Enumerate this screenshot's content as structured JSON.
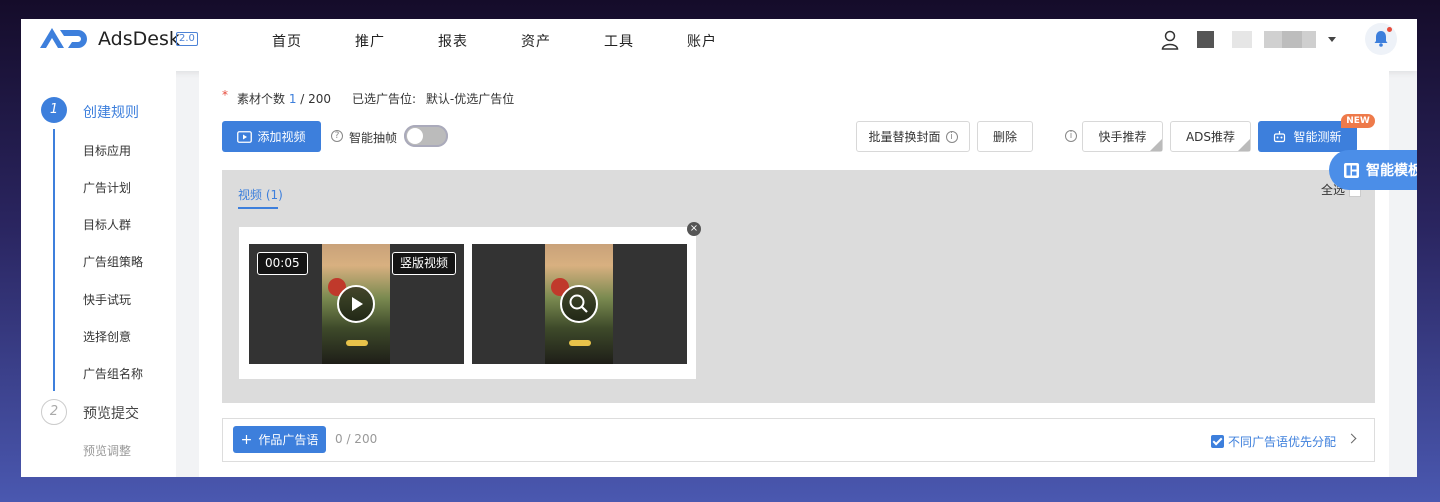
{
  "brand": {
    "name": "AdsDesk",
    "version": "2.0"
  },
  "nav": [
    "首页",
    "推广",
    "报表",
    "资产",
    "工具",
    "账户"
  ],
  "sidebar": {
    "step1": {
      "num": "1",
      "title": "创建规则"
    },
    "items": [
      "目标应用",
      "广告计划",
      "目标人群",
      "广告组策略",
      "快手试玩",
      "选择创意",
      "广告组名称"
    ],
    "step2": {
      "num": "2",
      "title": "预览提交"
    },
    "sub2": [
      "预览调整"
    ]
  },
  "main": {
    "required": "*",
    "count_label": "素材个数",
    "count_current": "1",
    "count_total": " / 200",
    "slot_label": "已选广告位:",
    "slot_value": "默认-优选广告位",
    "add_video": "添加视频",
    "smart_extract": "智能抽帧",
    "smart_extract_on": false,
    "batch_cover": "批量替换封面",
    "delete": "删除",
    "kuaishou_rec": "快手推荐",
    "ads_rec": "ADS推荐",
    "smart_test": "智能测新",
    "new_badge": "NEW",
    "smart_template": "智能模板",
    "tab_video": "视频 (1)",
    "select_all": "全选",
    "duration": "00:05",
    "vertical_tag": "竖版视频",
    "add_slogan": "作品广告语",
    "slogan_count": "0 / 200",
    "priority": "不同广告语优先分配"
  }
}
